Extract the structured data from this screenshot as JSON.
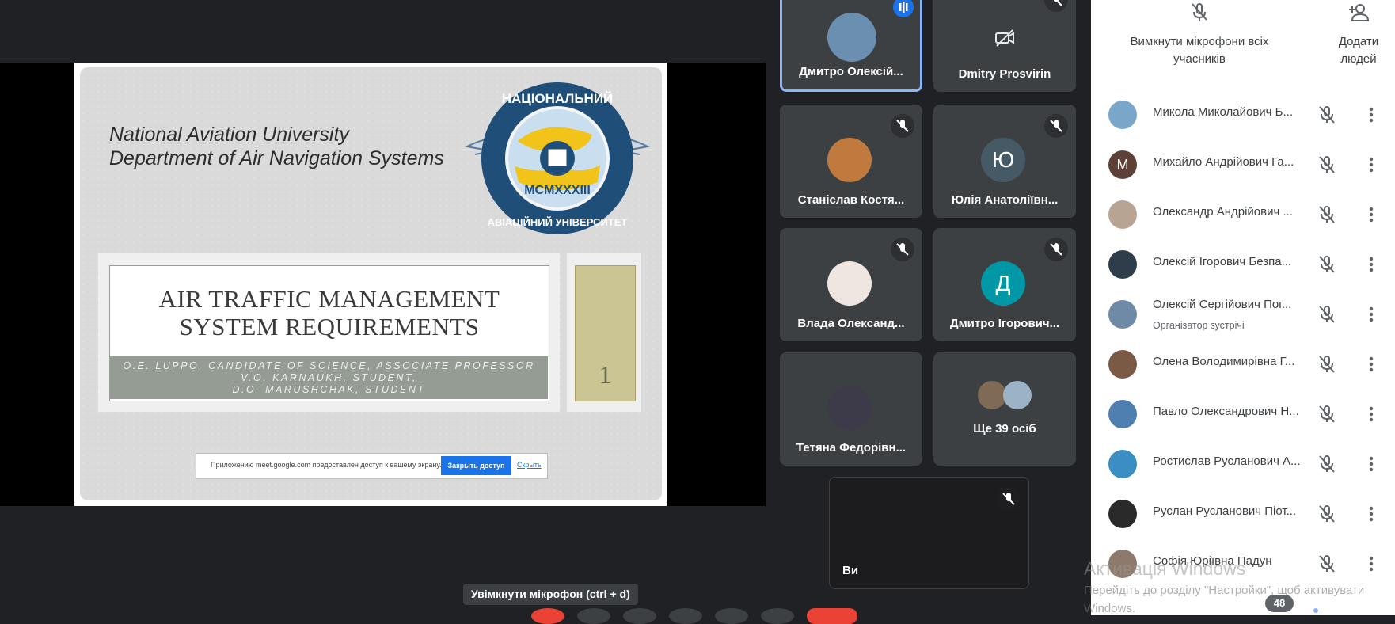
{
  "presentation": {
    "university": "National Aviation University",
    "department": "Department of Air Navigation Systems",
    "logo": {
      "top_text": "НАЦІОНАЛЬНИЙ",
      "bottom_text": "АВІАЦІЙНИЙ УНІВЕРСИТЕТ",
      "roman": "MCMXXXIII"
    },
    "title_line1": "AIR TRAFFIC MANAGEMENT",
    "title_line2": "SYSTEM REQUIREMENTS",
    "authors_line1": "O.E. LUPPO, CANDIDATE OF SCIENCE,  ASSOCIATE PROFESSOR",
    "authors_line2": "V.O. KARNAUKH, STUDENT,",
    "authors_line3": "D.O. MARUSHCHAK, STUDENT",
    "slide_number": "1",
    "share_notice": {
      "text": "Приложению meet.google.com предоставлен доступ к вашему экрану.",
      "button": "Закрыть доступ",
      "link": "Скрыть"
    }
  },
  "tiles": [
    {
      "name": "Дмитро Олексій...",
      "active": true
    },
    {
      "name": "Dmitry Prosvirin"
    },
    {
      "name": "Станіслав Костя..."
    },
    {
      "name": "Юлія Анатоліївн...",
      "letter": "Ю"
    },
    {
      "name": "Влада Олександ..."
    },
    {
      "name": "Дмитро Ігорович...",
      "letter": "Д"
    },
    {
      "name": "Тетяна Федорівн..."
    },
    {
      "name": "Ще 39 осіб"
    },
    {
      "name": "Ви"
    }
  ],
  "sidebar": {
    "mute_all_line1": "Вимкнути мікрофони всіх",
    "mute_all_line2": "учасників",
    "add_people_line1": "Додати",
    "add_people_line2": "людей",
    "participants": [
      {
        "name": "Микола Миколайович Б...",
        "avatar_color": "#7aa6c9"
      },
      {
        "name": "Михайло Андрійович Га...",
        "letter": "М",
        "avatar_color": "#5d4037"
      },
      {
        "name": "Олександр Андрійович ...",
        "avatar_color": "#b8a493"
      },
      {
        "name": "Олексій Ігорович Безпа...",
        "avatar_color": "#2f3d4b"
      },
      {
        "name": "Олексій Сергійович Пог...",
        "role": "Організатор зустрічі",
        "avatar_color": "#6f8aa6"
      },
      {
        "name": "Олена Володимирівна Г...",
        "avatar_color": "#7b5a45"
      },
      {
        "name": "Павло Олександрович Н...",
        "avatar_color": "#4f7fb0"
      },
      {
        "name": "Ростислав Русланович А...",
        "avatar_color": "#3b8ec4"
      },
      {
        "name": "Руслан Русланович Піот...",
        "avatar_color": "#2a2a2a"
      },
      {
        "name": "Софія Юріївна Падун",
        "avatar_color": "#8e7a6d"
      }
    ]
  },
  "tooltip": "Увімкнути мікрофон (ctrl + d)",
  "participant_count": "48",
  "windows_activation": {
    "line1": "Активація Windows",
    "line2": "Перейдіть до розділу \"Настройки\", щоб активувати",
    "line3": "Windows."
  },
  "colors": {
    "background": "#202124",
    "tile": "#3c4043",
    "active_border": "#8ab4f8",
    "end_call": "#ea4335",
    "accent": "#1a73e8"
  }
}
